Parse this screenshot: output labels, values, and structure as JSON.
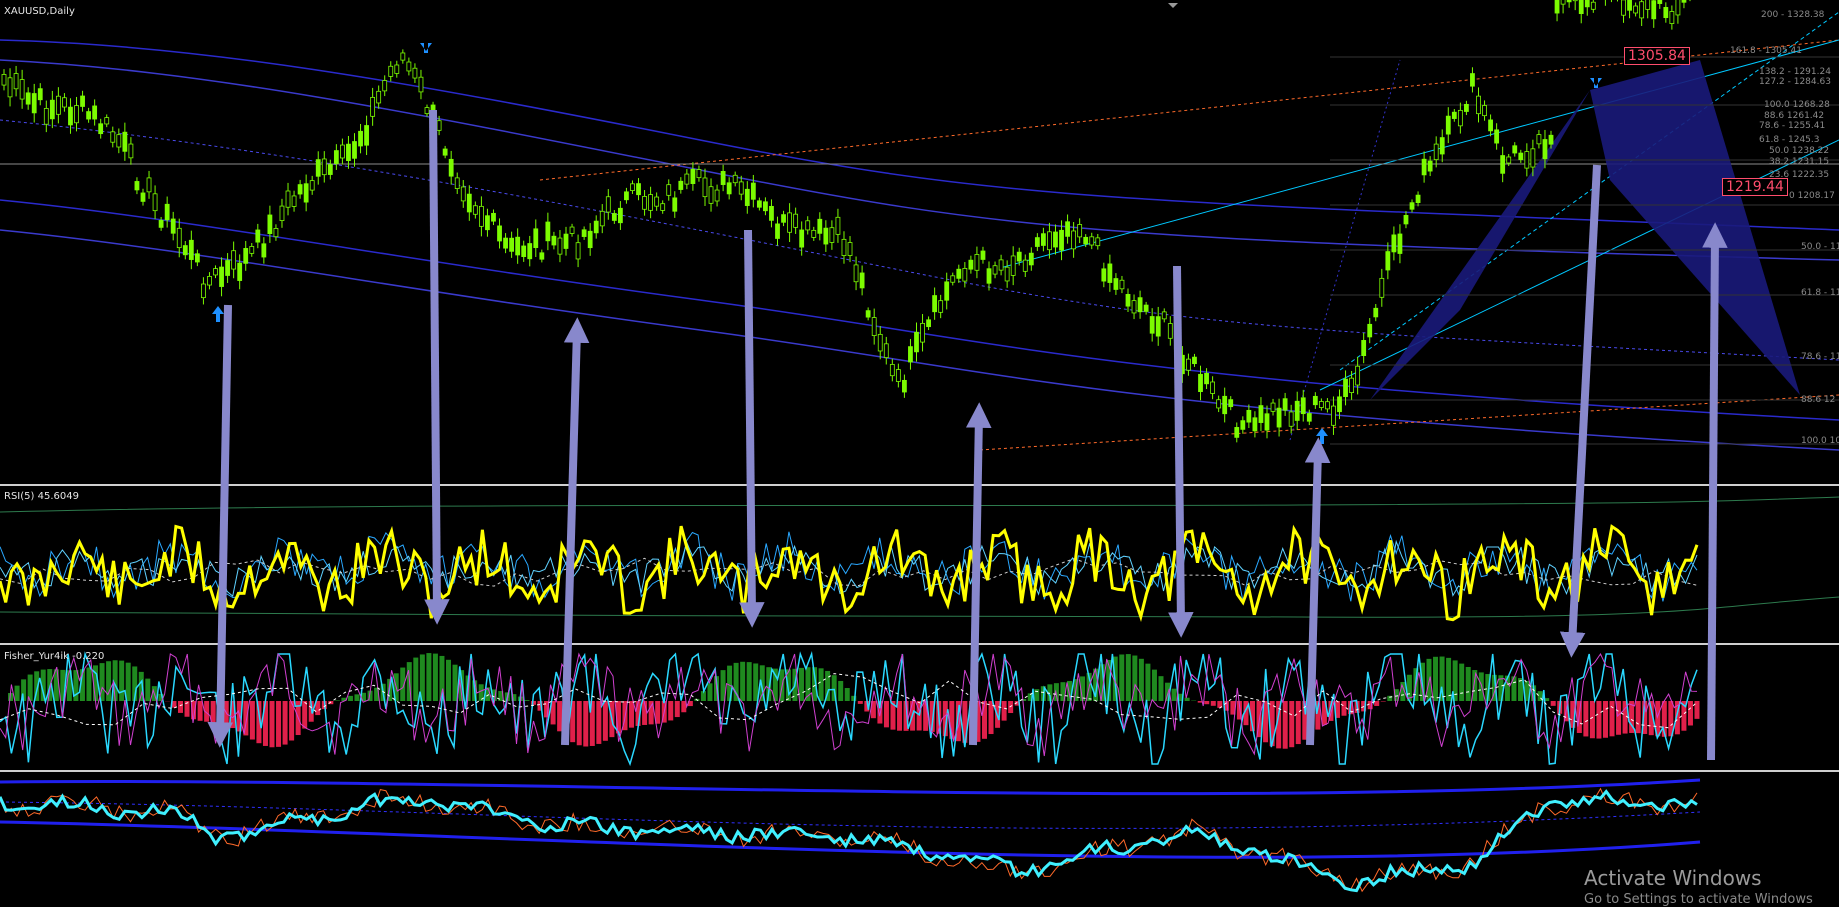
{
  "window": {
    "title": "XAUUSD,Daily"
  },
  "panes": {
    "main": {
      "title": "XAUUSD,Daily"
    },
    "rsi": {
      "title": "RSI(5) 45.6049"
    },
    "fisher": {
      "title": "Fisher_Yur4ik -0.220"
    }
  },
  "price_tags": {
    "high": "1305.84",
    "current": "1219.44"
  },
  "fib_levels": [
    "200 - 1328.38",
    "161.8 - 1305.41",
    "138.2 - 1291.24",
    "127.2 - 1284.63",
    "100.0 1268.28",
    "88.6 1261.42",
    "78.6 - 1255.41",
    "61.8 - 1245.3",
    "50.0 1238.22",
    "38.2 1231.15",
    "23.6 1222.35",
    "0 1208.17",
    "50.0 - 11",
    "61.8 - 11",
    "78.6 - 11",
    "88.6 12",
    "100.0 10"
  ],
  "watermark": {
    "title": "Activate Windows",
    "subtitle": "Go to Settings to activate Windows"
  },
  "colors": {
    "background": "#000000",
    "candles": "#7CFC00",
    "rsi_line": "#ffff00",
    "arrows": "#8888cc",
    "pattern": "#1a1a7a",
    "fisher_pos": "#1f8a1f",
    "fisher_neg": "#e0204a",
    "channel": "#00c8ff",
    "envelope": "#2a2acc",
    "resistance": "#ff6a2a"
  }
}
